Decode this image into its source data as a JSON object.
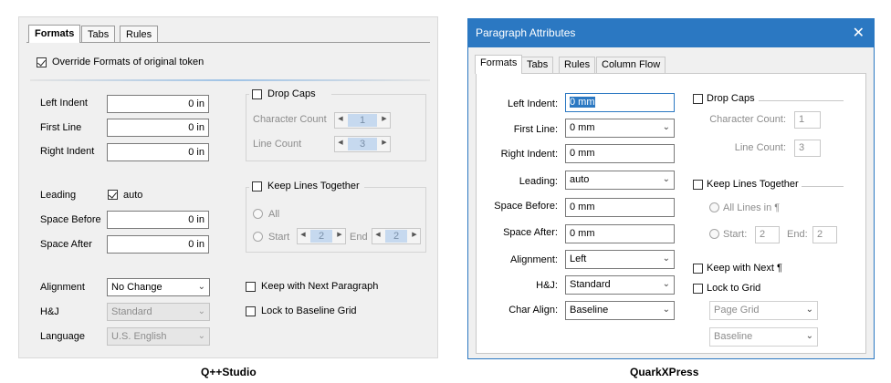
{
  "qstudio": {
    "caption": "Q++Studio",
    "tabs": [
      "Formats",
      "Tabs",
      "Rules"
    ],
    "override_label": "Override Formats of original token",
    "left_indent": {
      "label": "Left Indent",
      "value": "0 in"
    },
    "first_line": {
      "label": "First Line",
      "value": "0 in"
    },
    "right_indent": {
      "label": "Right Indent",
      "value": "0 in"
    },
    "leading": {
      "label": "Leading",
      "value": "auto"
    },
    "space_before": {
      "label": "Space Before",
      "value": "0 in"
    },
    "space_after": {
      "label": "Space After",
      "value": "0 in"
    },
    "alignment": {
      "label": "Alignment",
      "value": "No Change"
    },
    "hj": {
      "label": "H&J",
      "value": "Standard"
    },
    "language": {
      "label": "Language",
      "value": "U.S. English"
    },
    "drop_caps": {
      "label": "Drop Caps",
      "char_count_label": "Character Count",
      "char_count": "1",
      "line_count_label": "Line Count",
      "line_count": "3"
    },
    "keep_lines": {
      "label": "Keep Lines Together",
      "all_label": "All",
      "start_label": "Start",
      "start": "2",
      "end_label": "End",
      "end": "2"
    },
    "keep_next_label": "Keep with Next Paragraph",
    "lock_grid_label": "Lock to Baseline Grid"
  },
  "quark": {
    "caption": "QuarkXPress",
    "title": "Paragraph Attributes",
    "tabs": [
      "Formats",
      "Tabs",
      "Rules",
      "Column Flow"
    ],
    "left_indent": {
      "label": "Left Indent:",
      "value": "0 mm"
    },
    "first_line": {
      "label": "First Line:",
      "value": "0 mm"
    },
    "right_indent": {
      "label": "Right Indent:",
      "value": "0 mm"
    },
    "leading": {
      "label": "Leading:",
      "value": "auto"
    },
    "space_before": {
      "label": "Space Before:",
      "value": "0 mm"
    },
    "space_after": {
      "label": "Space After:",
      "value": "0 mm"
    },
    "alignment": {
      "label": "Alignment:",
      "value": "Left"
    },
    "hj": {
      "label": "H&J:",
      "value": "Standard"
    },
    "char_align": {
      "label": "Char Align:",
      "value": "Baseline"
    },
    "drop_caps": {
      "label": "Drop Caps",
      "char_count_label": "Character Count:",
      "char_count": "1",
      "line_count_label": "Line Count:",
      "line_count": "3"
    },
    "keep_lines": {
      "label": "Keep Lines Together",
      "all_label": "All Lines in ¶",
      "start_label": "Start:",
      "start": "2",
      "end_label": "End:",
      "end": "2"
    },
    "keep_next_label": "Keep with Next ¶",
    "lock_grid_label": "Lock to Grid",
    "grid_option": "Page Grid",
    "grid_align": "Baseline"
  }
}
